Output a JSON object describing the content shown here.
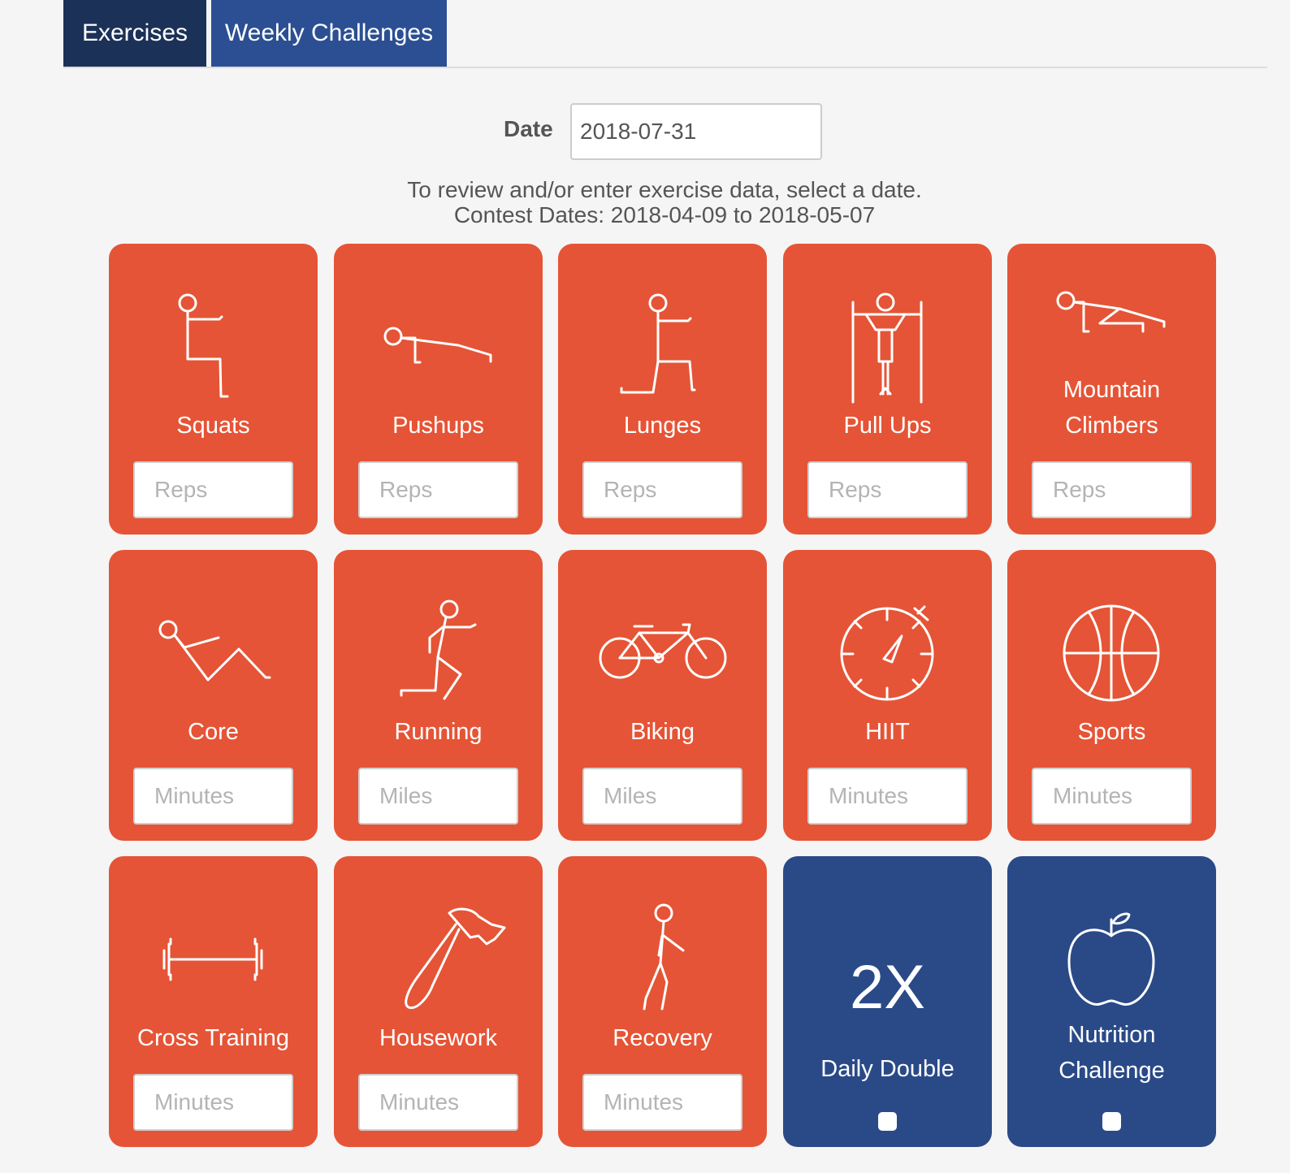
{
  "tabs": [
    {
      "label": "Exercises",
      "active": true
    },
    {
      "label": "Weekly Challenges",
      "active": false
    }
  ],
  "date": {
    "label": "Date",
    "value": "2018-07-31"
  },
  "info": {
    "line1": "To review and/or enter exercise data, select a date.",
    "line2": "Contest Dates: 2018-04-09 to 2018-05-07"
  },
  "colors": {
    "orange": "#e55436",
    "navy": "#1c3158",
    "blue": "#2a4a87"
  },
  "cards": [
    {
      "label": "Squats",
      "icon": "squat-icon",
      "placeholder": "Reps"
    },
    {
      "label": "Pushups",
      "icon": "pushup-icon",
      "placeholder": "Reps"
    },
    {
      "label": "Lunges",
      "icon": "lunge-icon",
      "placeholder": "Reps"
    },
    {
      "label": "Pull Ups",
      "icon": "pullup-icon",
      "placeholder": "Reps"
    },
    {
      "label_line1": "Mountain",
      "label_line2": "Climbers",
      "icon": "mountain-climber-icon",
      "placeholder": "Reps"
    },
    {
      "label": "Core",
      "icon": "situp-icon",
      "placeholder": "Minutes"
    },
    {
      "label": "Running",
      "icon": "runner-icon",
      "placeholder": "Miles"
    },
    {
      "label": "Biking",
      "icon": "bicycle-icon",
      "placeholder": "Miles"
    },
    {
      "label": "HIIT",
      "icon": "stopwatch-icon",
      "placeholder": "Minutes"
    },
    {
      "label": "Sports",
      "icon": "basketball-icon",
      "placeholder": "Minutes"
    },
    {
      "label": "Cross Training",
      "icon": "barbell-icon",
      "placeholder": "Minutes"
    },
    {
      "label": "Housework",
      "icon": "hammer-icon",
      "placeholder": "Minutes"
    },
    {
      "label": "Recovery",
      "icon": "walking-icon",
      "placeholder": "Minutes"
    },
    {
      "big": "2X",
      "label": "Daily Double",
      "checked": false
    },
    {
      "label_line1": "Nutrition",
      "label_line2": "Challenge",
      "icon": "apple-icon",
      "checked": false
    }
  ]
}
